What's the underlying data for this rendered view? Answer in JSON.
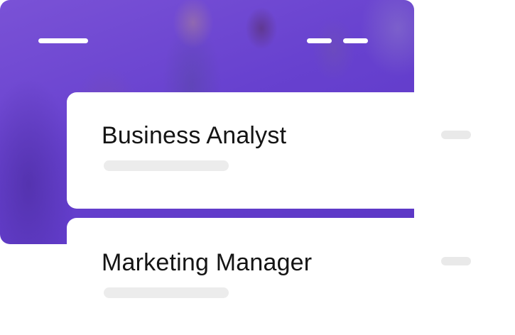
{
  "cards": [
    {
      "title": "Business Analyst"
    },
    {
      "title": "Marketing Manager"
    }
  ],
  "colors": {
    "hero_purple": "#6741cf",
    "placeholder_gray": "#ececec",
    "text": "#141414"
  }
}
